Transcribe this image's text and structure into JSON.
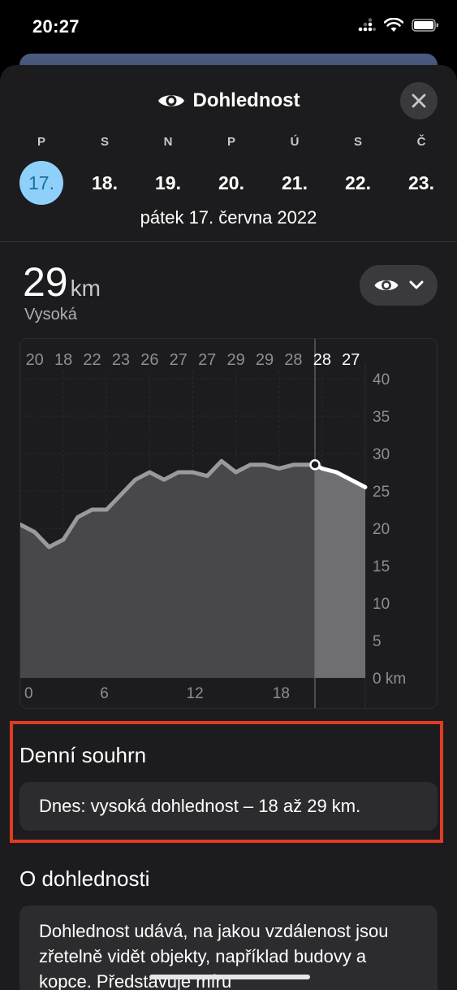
{
  "status_bar": {
    "time": "20:27"
  },
  "sheet": {
    "title": "Dohlednost",
    "title_icon": "eye-icon",
    "close_icon": "close-icon"
  },
  "days": [
    {
      "letter": "P",
      "num": "17.",
      "selected": true
    },
    {
      "letter": "S",
      "num": "18."
    },
    {
      "letter": "N",
      "num": "19."
    },
    {
      "letter": "P",
      "num": "20."
    },
    {
      "letter": "Ú",
      "num": "21."
    },
    {
      "letter": "S",
      "num": "22."
    },
    {
      "letter": "Č",
      "num": "23."
    }
  ],
  "full_date": "pátek 17. června 2022",
  "current": {
    "value": "29",
    "unit": "km",
    "label": "Vysoká"
  },
  "metric_selector": {
    "icon": "eye-icon",
    "chevron": "chevron-down-icon"
  },
  "chart_data": {
    "type": "area",
    "hourly_labels": [
      "20",
      "18",
      "22",
      "23",
      "26",
      "27",
      "27",
      "29",
      "29",
      "28",
      "28",
      "27"
    ],
    "y_ticks": [
      "40",
      "35",
      "30",
      "25",
      "20",
      "15",
      "10",
      "5",
      "0 km"
    ],
    "x_ticks": [
      "0",
      "6",
      "12",
      "18"
    ],
    "ylim": [
      0,
      40
    ],
    "xlim": [
      0,
      24
    ],
    "current_hour": 20.5,
    "x": [
      0,
      1,
      2,
      3,
      4,
      5,
      6,
      7,
      8,
      9,
      10,
      11,
      12,
      13,
      14,
      15,
      16,
      17,
      18,
      19,
      20,
      20.5,
      21,
      22,
      23,
      24
    ],
    "y": [
      20.5,
      19.5,
      17.5,
      18.5,
      21.5,
      22.5,
      22.5,
      24.5,
      26.5,
      27.5,
      26.5,
      27.5,
      27.5,
      27,
      29,
      27.5,
      28.5,
      28.5,
      28,
      28.5,
      28.5,
      28.5,
      28,
      27.5,
      26.5,
      25.5
    ],
    "colors": {
      "past_line": "#9a9a9e",
      "future_line": "#ffffff",
      "past_fill": "#48484a",
      "future_fill": "#6e6e73"
    }
  },
  "daily_summary": {
    "title": "Denní souhrn",
    "text": "Dnes: vysoká dohlednost – 18 až 29 km."
  },
  "about": {
    "title": "O dohlednosti",
    "text": "Dohlednost udává, na jakou vzdálenost jsou zřetelně vidět objekty, například budovy a kopce. Představuje míru"
  },
  "colors": {
    "selected_day_bg": "#8fd0fb",
    "highlight": "#e13a22"
  }
}
